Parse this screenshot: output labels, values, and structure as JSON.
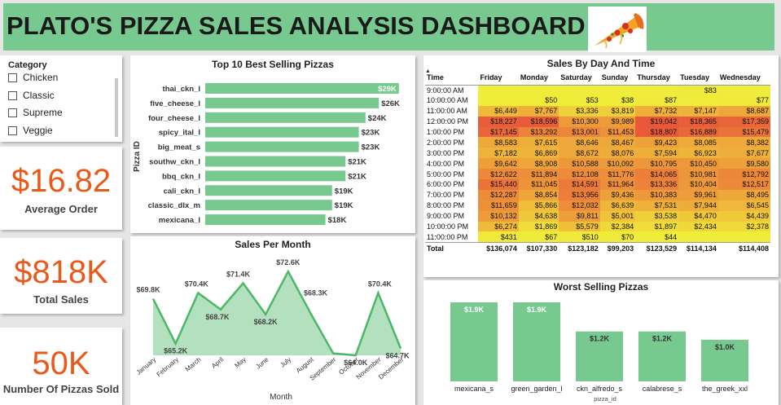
{
  "header": {
    "title": "PLATO'S PIZZA SALES ANALYSIS DASHBOARD"
  },
  "category": {
    "title": "Category",
    "items": [
      "Chicken",
      "Classic",
      "Supreme",
      "Veggie"
    ]
  },
  "kpis": [
    {
      "value": "$16.82",
      "label": "Average Order"
    },
    {
      "value": "$818K",
      "label": "Total Sales"
    },
    {
      "value": "50K",
      "label": "Number Of Pizzas Sold"
    }
  ],
  "chart_data": [
    {
      "type": "bar",
      "orientation": "horizontal",
      "title": "Top 10 Best Selling Pizzas",
      "ylabel": "Pizza ID",
      "categories": [
        "thai_ckn_l",
        "five_cheese_l",
        "four_cheese_l",
        "spicy_ital_l",
        "big_meat_s",
        "southw_ckn_l",
        "bbq_ckn_l",
        "cali_ckn_l",
        "classic_dlx_m",
        "mexicana_l"
      ],
      "values": [
        29,
        26,
        24,
        23,
        23,
        21,
        21,
        19,
        19,
        18
      ],
      "labels": [
        "$29K",
        "$26K",
        "$24K",
        "$23K",
        "$23K",
        "$21K",
        "$21K",
        "$19K",
        "$19K",
        "$18K"
      ],
      "xlim": [
        0,
        30
      ],
      "color": "#78c98f"
    },
    {
      "type": "area",
      "title": "Sales Per Month",
      "xlabel": "Month",
      "categories": [
        "January",
        "February",
        "March",
        "April",
        "May",
        "June",
        "July",
        "August",
        "September",
        "October",
        "November",
        "December"
      ],
      "values": [
        69.8,
        65.2,
        70.4,
        68.7,
        71.4,
        68.2,
        72.6,
        68.3,
        64.2,
        64.0,
        70.4,
        64.7
      ],
      "labels": [
        "$69.8K",
        "$65.2K",
        "$70.4K",
        "$68.7K",
        "$71.4K",
        "$68.2K",
        "$72.6K",
        "$68.3K",
        "",
        "$64.0K",
        "$70.4K",
        "$64.7K"
      ],
      "ylim": [
        64.0,
        73.2
      ],
      "line_color": "#4cb866",
      "fill_color": "#b3e0bf"
    },
    {
      "type": "heatmap",
      "title": "Sales By Day And Time",
      "row_header": "Time",
      "columns": [
        "Friday",
        "Monday",
        "Saturday",
        "Sunday",
        "Thursday",
        "Tuesday",
        "Wednesday"
      ],
      "rows": [
        {
          "time": "9:00:00 AM",
          "cells": [
            "",
            "",
            "",
            "",
            "",
            "$83",
            ""
          ]
        },
        {
          "time": "10:00:00 AM",
          "cells": [
            "",
            "$50",
            "$53",
            "$38",
            "$87",
            "",
            "$77"
          ]
        },
        {
          "time": "11:00:00 AM",
          "cells": [
            "$6,449",
            "$7,767",
            "$3,336",
            "$3,819",
            "$7,732",
            "$7,147",
            "$8,687"
          ]
        },
        {
          "time": "12:00:00 PM",
          "cells": [
            "$18,227",
            "$18,596",
            "$10,300",
            "$9,989",
            "$19,042",
            "$18,365",
            "$17,359"
          ]
        },
        {
          "time": "1:00:00 PM",
          "cells": [
            "$17,145",
            "$13,292",
            "$13,001",
            "$11,453",
            "$18,807",
            "$16,889",
            "$15,479"
          ]
        },
        {
          "time": "2:00:00 PM",
          "cells": [
            "$8,583",
            "$7,615",
            "$8,646",
            "$8,467",
            "$9,423",
            "$8,085",
            "$8,382"
          ]
        },
        {
          "time": "3:00:00 PM",
          "cells": [
            "$7,182",
            "$6,869",
            "$8,672",
            "$8,076",
            "$7,594",
            "$6,923",
            "$7,677"
          ]
        },
        {
          "time": "4:00:00 PM",
          "cells": [
            "$9,642",
            "$8,908",
            "$10,588",
            "$10,092",
            "$10,795",
            "$10,450",
            "$9,580"
          ]
        },
        {
          "time": "5:00:00 PM",
          "cells": [
            "$12,622",
            "$11,894",
            "$12,108",
            "$11,776",
            "$14,065",
            "$10,981",
            "$12,792"
          ]
        },
        {
          "time": "6:00:00 PM",
          "cells": [
            "$15,440",
            "$11,045",
            "$14,591",
            "$11,964",
            "$13,336",
            "$10,404",
            "$12,517"
          ]
        },
        {
          "time": "7:00:00 PM",
          "cells": [
            "$12,287",
            "$8,854",
            "$13,956",
            "$9,436",
            "$10,383",
            "$9,961",
            "$8,495"
          ]
        },
        {
          "time": "8:00:00 PM",
          "cells": [
            "$11,659",
            "$5,866",
            "$12,032",
            "$6,639",
            "$7,531",
            "$7,944",
            "$6,545"
          ]
        },
        {
          "time": "9:00:00 PM",
          "cells": [
            "$10,132",
            "$4,638",
            "$9,811",
            "$5,001",
            "$3,538",
            "$4,470",
            "$4,439"
          ]
        },
        {
          "time": "10:00:00 PM",
          "cells": [
            "$6,274",
            "$1,869",
            "$5,579",
            "$2,384",
            "$1,897",
            "$2,434",
            "$2,378"
          ]
        },
        {
          "time": "11:00:00 PM",
          "cells": [
            "$431",
            "$67",
            "$510",
            "$70",
            "$44",
            "",
            ""
          ]
        }
      ],
      "total_label": "Total",
      "totals": [
        "$136,074",
        "$107,330",
        "$123,182",
        "$99,203",
        "$123,529",
        "$114,134",
        "$114,408"
      ],
      "color_low": "#f0ec3a",
      "color_high": "#e8583a"
    },
    {
      "type": "bar",
      "title": "Worst Selling Pizzas",
      "xlabel": "pizza_id",
      "categories": [
        "mexicana_s",
        "green_garden_l",
        "ckn_alfredo_s",
        "calabrese_s",
        "the_greek_xxl"
      ],
      "values": [
        1.9,
        1.9,
        1.2,
        1.2,
        1.0
      ],
      "labels": [
        "$1.9K",
        "$1.9K",
        "$1.2K",
        "$1.2K",
        "$1.0K"
      ],
      "ylim": [
        0,
        1.9
      ],
      "color": "#78c98f"
    }
  ]
}
